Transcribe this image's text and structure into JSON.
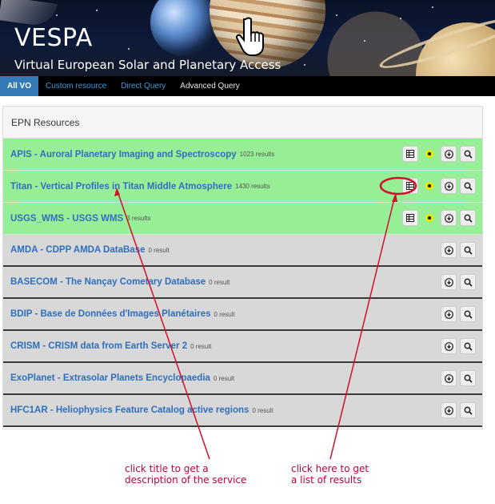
{
  "banner": {
    "title": "VESPA",
    "subtitle": "Virtual European Solar and Planetary Access"
  },
  "nav": {
    "tabs": [
      {
        "label": "All VO",
        "active": true
      },
      {
        "label": "Custom resource",
        "active": false
      },
      {
        "label": "Direct Query",
        "active": false
      },
      {
        "label": "Advanced Query",
        "active": false
      }
    ]
  },
  "panel": {
    "heading": "EPN Resources",
    "rows": [
      {
        "title": "APIS - Auroral Planetary Imaging and Spectroscopy",
        "count": "1023 results",
        "status": "green",
        "buttons": [
          "table-icon",
          "yellow-dot-icon",
          "download-icon",
          "search-icon"
        ]
      },
      {
        "title": "Titan - Vertical Profiles in Titan Middle Atmosphere",
        "count": "1430 results",
        "status": "green",
        "buttons": [
          "table-icon",
          "yellow-dot-icon",
          "download-icon",
          "search-icon"
        ]
      },
      {
        "title": "USGS_WMS - USGS WMS",
        "count": "3 results",
        "status": "green",
        "buttons": [
          "table-icon",
          "yellow-dot-icon",
          "download-icon",
          "search-icon"
        ]
      },
      {
        "title": "AMDA - CDPP AMDA DataBase",
        "count": "0 result",
        "status": "grey",
        "buttons": [
          "download-icon",
          "search-icon"
        ]
      },
      {
        "title": "BASECOM - The Nançay Cometary Database",
        "count": "0 result",
        "status": "grey",
        "buttons": [
          "download-icon",
          "search-icon"
        ]
      },
      {
        "title": "BDIP - Base de Données d'Images Planétaires",
        "count": "0 result",
        "status": "grey",
        "buttons": [
          "download-icon",
          "search-icon"
        ]
      },
      {
        "title": "CRISM - CRISM data from Earth Server 2",
        "count": "0 result",
        "status": "grey",
        "buttons": [
          "download-icon",
          "search-icon"
        ]
      },
      {
        "title": "ExoPlanet - Extrasolar Planets Encyclopaedia",
        "count": "0 result",
        "status": "grey",
        "buttons": [
          "download-icon",
          "search-icon"
        ]
      },
      {
        "title": "HFC1AR - Heliophysics Feature Catalog active regions",
        "count": "0 result",
        "status": "grey",
        "buttons": [
          "download-icon",
          "search-icon"
        ]
      }
    ]
  },
  "annotations": {
    "left": "click title to get a\ndescription of the service",
    "right": "click here to get\na list of results",
    "color": "#c00040"
  },
  "colors": {
    "green_row": "#96ee96",
    "grey_row": "#d8d8d8",
    "title_link": "#2f6fbf",
    "nav_active": "#337ab7"
  }
}
